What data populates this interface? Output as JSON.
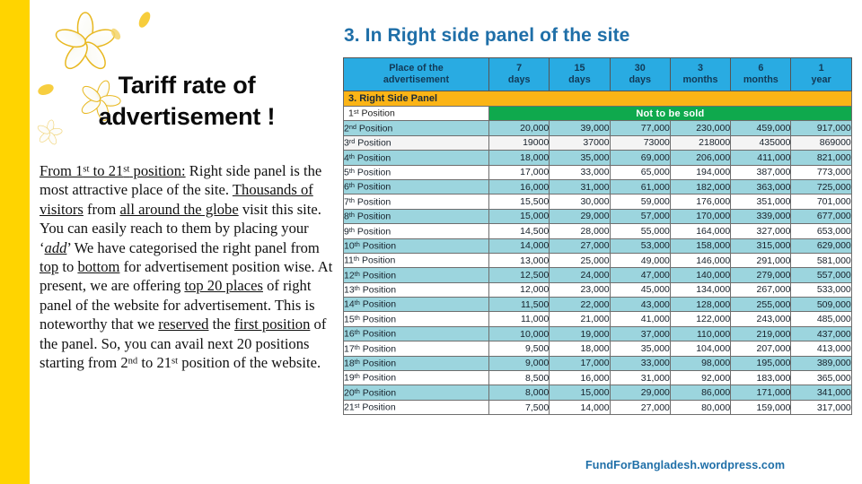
{
  "decor": {
    "left_bar_color": "#FFD400",
    "flower_petal_color": "#FFFFFF",
    "flower_edge_color": "#E8B820"
  },
  "slide": {
    "title": "Tariff  rate of advertisement !",
    "section_heading": "3. In Right side panel of the site",
    "footer_url": "FundForBangladesh.wordpress.com",
    "heading_color": "#1F6FA8"
  },
  "body": {
    "lead_label": "From 1st to 21st position:",
    "paragraph": "From 1st to 21st position: Right side panel is the most attractive place of the site. Thousands of visitors from all around the globe visit this site. You can easily reach to them by placing your ‘add’ We have categorised the right panel from top to bottom for advertisement position wise. At present, we are offering top 20 places of right panel of the website for advertisement. This is noteworthy that we reserved the first position of the panel. So, you can avail next 20 positions starting from 2nd to 21st position of the website."
  },
  "chart_data": {
    "type": "table",
    "title": "3. In Right side panel of the site",
    "band_label": "3. Right Side Panel",
    "not_for_sale_label": "Not to be sold",
    "columns": [
      "Place of the advertisement",
      "7 days",
      "15 days",
      "30 days",
      "3 months",
      "6 months",
      "1 year"
    ],
    "columns_split": [
      [
        "Place of the",
        "advertisement"
      ],
      [
        "7",
        "days"
      ],
      [
        "15",
        "days"
      ],
      [
        "30",
        "days"
      ],
      [
        "3",
        "months"
      ],
      [
        "6",
        "months"
      ],
      [
        "1",
        "year"
      ]
    ],
    "rows": [
      {
        "position": "1",
        "suffix": "st",
        "label": "Position",
        "not_for_sale": true,
        "values": []
      },
      {
        "position": "2",
        "suffix": "nd",
        "label": "Position",
        "not_for_sale": false,
        "values": [
          "20,000",
          "39,000",
          "77,000",
          "230,000",
          "459,000",
          "917,000"
        ]
      },
      {
        "position": "3",
        "suffix": "rd",
        "label": "Position",
        "not_for_sale": false,
        "values": [
          "19000",
          "37000",
          "73000",
          "218000",
          "435000",
          "869000"
        ]
      },
      {
        "position": "4",
        "suffix": "th",
        "label": "Position",
        "not_for_sale": false,
        "values": [
          "18,000",
          "35,000",
          "69,000",
          "206,000",
          "411,000",
          "821,000"
        ]
      },
      {
        "position": "5",
        "suffix": "th",
        "label": "Position",
        "not_for_sale": false,
        "values": [
          "17,000",
          "33,000",
          "65,000",
          "194,000",
          "387,000",
          "773,000"
        ]
      },
      {
        "position": "6",
        "suffix": "th",
        "label": "Position",
        "not_for_sale": false,
        "values": [
          "16,000",
          "31,000",
          "61,000",
          "182,000",
          "363,000",
          "725,000"
        ]
      },
      {
        "position": "7",
        "suffix": "th",
        "label": "Position",
        "not_for_sale": false,
        "values": [
          "15,500",
          "30,000",
          "59,000",
          "176,000",
          "351,000",
          "701,000"
        ]
      },
      {
        "position": "8",
        "suffix": "th",
        "label": "Position",
        "not_for_sale": false,
        "values": [
          "15,000",
          "29,000",
          "57,000",
          "170,000",
          "339,000",
          "677,000"
        ]
      },
      {
        "position": "9",
        "suffix": "th",
        "label": "Position",
        "not_for_sale": false,
        "values": [
          "14,500",
          "28,000",
          "55,000",
          "164,000",
          "327,000",
          "653,000"
        ]
      },
      {
        "position": "10",
        "suffix": "th",
        "label": "Position",
        "not_for_sale": false,
        "values": [
          "14,000",
          "27,000",
          "53,000",
          "158,000",
          "315,000",
          "629,000"
        ]
      },
      {
        "position": "11",
        "suffix": "th",
        "label": "Position",
        "not_for_sale": false,
        "values": [
          "13,000",
          "25,000",
          "49,000",
          "146,000",
          "291,000",
          "581,000"
        ]
      },
      {
        "position": "12",
        "suffix": "th",
        "label": "Position",
        "not_for_sale": false,
        "values": [
          "12,500",
          "24,000",
          "47,000",
          "140,000",
          "279,000",
          "557,000"
        ]
      },
      {
        "position": "13",
        "suffix": "th",
        "label": "Position",
        "not_for_sale": false,
        "values": [
          "12,000",
          "23,000",
          "45,000",
          "134,000",
          "267,000",
          "533,000"
        ]
      },
      {
        "position": "14",
        "suffix": "th",
        "label": "Position",
        "not_for_sale": false,
        "values": [
          "11,500",
          "22,000",
          "43,000",
          "128,000",
          "255,000",
          "509,000"
        ]
      },
      {
        "position": "15",
        "suffix": "th",
        "label": "Position",
        "not_for_sale": false,
        "values": [
          "11,000",
          "21,000",
          "41,000",
          "122,000",
          "243,000",
          "485,000"
        ]
      },
      {
        "position": "16",
        "suffix": "th",
        "label": "Position",
        "not_for_sale": false,
        "values": [
          "10,000",
          "19,000",
          "37,000",
          "110,000",
          "219,000",
          "437,000"
        ]
      },
      {
        "position": "17",
        "suffix": "th",
        "label": "Position",
        "not_for_sale": false,
        "values": [
          "9,500",
          "18,000",
          "35,000",
          "104,000",
          "207,000",
          "413,000"
        ]
      },
      {
        "position": "18",
        "suffix": "th",
        "label": "Position",
        "not_for_sale": false,
        "values": [
          "9,000",
          "17,000",
          "33,000",
          "98,000",
          "195,000",
          "389,000"
        ]
      },
      {
        "position": "19",
        "suffix": "th",
        "label": "Position",
        "not_for_sale": false,
        "values": [
          "8,500",
          "16,000",
          "31,000",
          "92,000",
          "183,000",
          "365,000"
        ]
      },
      {
        "position": "20",
        "suffix": "th",
        "label": "Position",
        "not_for_sale": false,
        "values": [
          "8,000",
          "15,000",
          "29,000",
          "86,000",
          "171,000",
          "341,000"
        ]
      },
      {
        "position": "21",
        "suffix": "st",
        "label": "Position",
        "not_for_sale": false,
        "values": [
          "7,500",
          "14,000",
          "27,000",
          "80,000",
          "159,000",
          "317,000"
        ]
      }
    ],
    "colors": {
      "header_bg": "#29ABE2",
      "band_bg": "#FBB416",
      "not_for_sale_bg": "#0FA94D",
      "row_alt_bg": "#9CD5DE",
      "row_plain_bg": "#FFFFFF",
      "border": "#6E6E6E"
    }
  }
}
